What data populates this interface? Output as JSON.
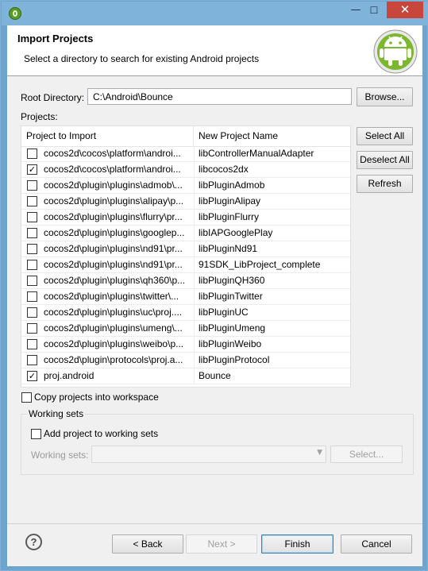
{
  "window": {
    "minimize_glyph": "—",
    "maximize_glyph": "☐",
    "close_glyph": "✕"
  },
  "header": {
    "title": "Import Projects",
    "description": "Select a directory to search for existing Android projects"
  },
  "root_directory": {
    "label": "Root Directory:",
    "value": "C:\\Android\\Bounce",
    "browse_label": "Browse..."
  },
  "projects": {
    "label": "Projects:",
    "columns": [
      "Project to Import",
      "New Project Name"
    ],
    "rows": [
      {
        "checked": false,
        "project": "cocos2d\\cocos\\platform\\androi...",
        "name": "libControllerManualAdapter"
      },
      {
        "checked": true,
        "project": "cocos2d\\cocos\\platform\\androi...",
        "name": "libcocos2dx"
      },
      {
        "checked": false,
        "project": "cocos2d\\plugin\\plugins\\admob\\...",
        "name": "libPluginAdmob"
      },
      {
        "checked": false,
        "project": "cocos2d\\plugin\\plugins\\alipay\\p...",
        "name": "libPluginAlipay"
      },
      {
        "checked": false,
        "project": "cocos2d\\plugin\\plugins\\flurry\\pr...",
        "name": "libPluginFlurry"
      },
      {
        "checked": false,
        "project": "cocos2d\\plugin\\plugins\\googlep...",
        "name": "libIAPGooglePlay"
      },
      {
        "checked": false,
        "project": "cocos2d\\plugin\\plugins\\nd91\\pr...",
        "name": "libPluginNd91"
      },
      {
        "checked": false,
        "project": "cocos2d\\plugin\\plugins\\nd91\\pr...",
        "name": "91SDK_LibProject_complete"
      },
      {
        "checked": false,
        "project": "cocos2d\\plugin\\plugins\\qh360\\p...",
        "name": "libPluginQH360"
      },
      {
        "checked": false,
        "project": "cocos2d\\plugin\\plugins\\twitter\\...",
        "name": "libPluginTwitter"
      },
      {
        "checked": false,
        "project": "cocos2d\\plugin\\plugins\\uc\\proj....",
        "name": "libPluginUC"
      },
      {
        "checked": false,
        "project": "cocos2d\\plugin\\plugins\\umeng\\...",
        "name": "libPluginUmeng"
      },
      {
        "checked": false,
        "project": "cocos2d\\plugin\\plugins\\weibo\\p...",
        "name": "libPluginWeibo"
      },
      {
        "checked": false,
        "project": "cocos2d\\plugin\\protocols\\proj.a...",
        "name": "libPluginProtocol"
      },
      {
        "checked": true,
        "project": "proj.android",
        "name": "Bounce"
      }
    ],
    "select_all_label": "Select All",
    "deselect_all_label": "Deselect All",
    "refresh_label": "Refresh"
  },
  "copy_into_workspace": {
    "label": "Copy projects into workspace",
    "checked": false
  },
  "working_sets": {
    "title": "Working sets",
    "add_label": "Add project to working sets",
    "add_checked": false,
    "sets_label": "Working sets:",
    "sets_value": "",
    "select_label": "Select..."
  },
  "footer": {
    "help_glyph": "?",
    "back_label": "< Back",
    "next_label": "Next >",
    "finish_label": "Finish",
    "cancel_label": "Cancel"
  }
}
